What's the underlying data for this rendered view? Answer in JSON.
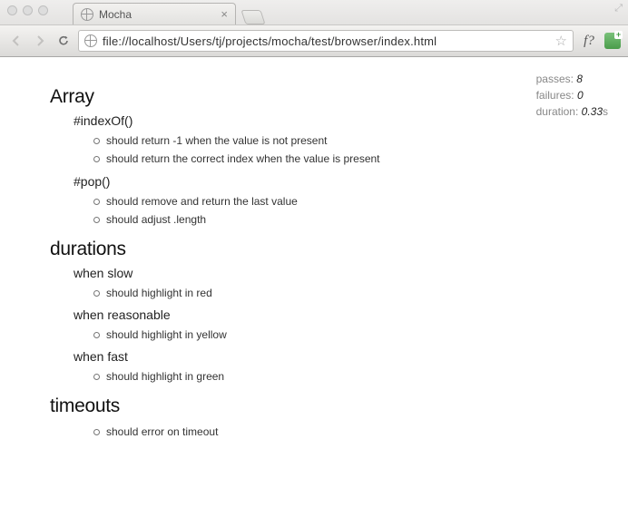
{
  "browser": {
    "tab_title": "Mocha",
    "url": "file://localhost/Users/tj/projects/mocha/test/browser/index.html",
    "ext_label": "f?"
  },
  "stats": {
    "passes_label": "passes:",
    "passes": "8",
    "failures_label": "failures:",
    "failures": "0",
    "duration_label": "duration:",
    "duration": "0.33",
    "duration_unit": "s"
  },
  "suites": [
    {
      "title": "Array",
      "children": [
        {
          "title": "#indexOf()",
          "tests": [
            "should return -1 when the value is not present",
            "should return the correct index when the value is present"
          ]
        },
        {
          "title": "#pop()",
          "tests": [
            "should remove and return the last value",
            "should adjust .length"
          ]
        }
      ]
    },
    {
      "title": "durations",
      "children": [
        {
          "title": "when slow",
          "tests": [
            "should highlight in red"
          ]
        },
        {
          "title": "when reasonable",
          "tests": [
            "should highlight in yellow"
          ]
        },
        {
          "title": "when fast",
          "tests": [
            "should highlight in green"
          ]
        }
      ]
    },
    {
      "title": "timeouts",
      "tests": [
        "should error on timeout"
      ]
    }
  ]
}
